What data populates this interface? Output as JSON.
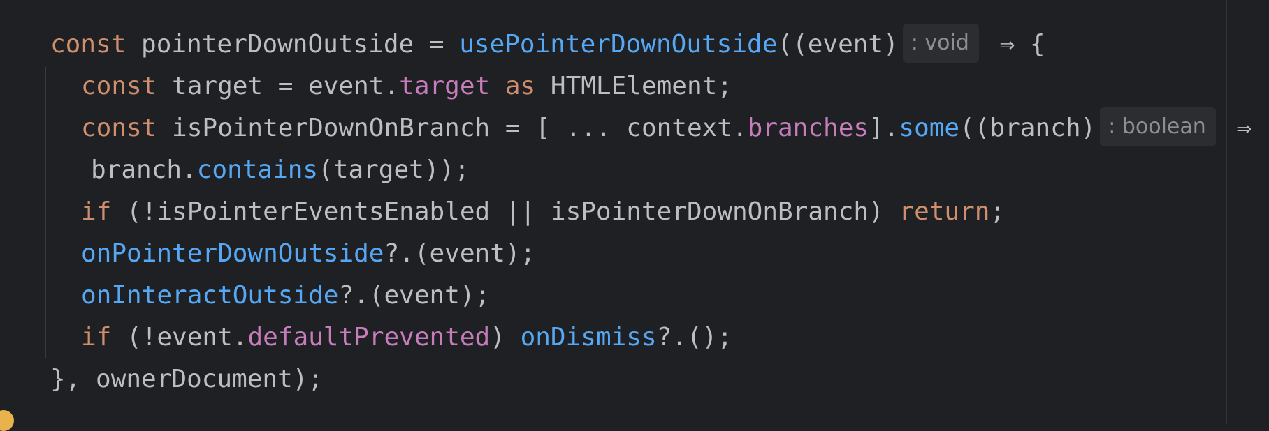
{
  "code": {
    "line1": {
      "kw_const": "const",
      "name": " pointerDownOutside",
      "eq": " = ",
      "call": "usePointerDownOutside",
      "args": "((event)",
      "hint": ": void",
      "arrow": " ⇒ {"
    },
    "line2": {
      "kw_const": "const",
      "name": " target = event.",
      "prop": "target",
      "kw_as": " as",
      "rest": " HTMLElement;"
    },
    "line3": {
      "kw_const": "const",
      "name": " isPointerDownOnBranch = [ ... context.",
      "prop": "branches",
      "mid": "].",
      "call": "some",
      "args": "((branch)",
      "hint": ": boolean",
      "arrow": " ⇒"
    },
    "line4": {
      "pre": "branch.",
      "call": "contains",
      "rest": "(target));"
    },
    "line5": {
      "kw_if": "if",
      "cond": " (!isPointerEventsEnabled || isPointerDownOnBranch) ",
      "kw_return": "return",
      "semi": ";"
    },
    "line6": {
      "call": "onPointerDownOutside",
      "rest": "?.(event);"
    },
    "line7": {
      "call": "onInteractOutside",
      "rest": "?.(event);"
    },
    "line8": {
      "kw_if": "if",
      "pre": " (!event.",
      "prop": "defaultPrevented",
      "mid": ") ",
      "call": "onDismiss",
      "rest": "?.();"
    },
    "line9": {
      "text": "}, ownerDocument);"
    }
  },
  "colors": {
    "background": "#1f2023",
    "keyword": "#cf8e6d",
    "function": "#56a8f5",
    "property": "#c77dbb",
    "identifier": "#bcbec4",
    "inlay_hint_bg": "#2b2d30",
    "inlay_hint_fg": "#8c8f94",
    "gutter_marker": "#e8b34a"
  }
}
